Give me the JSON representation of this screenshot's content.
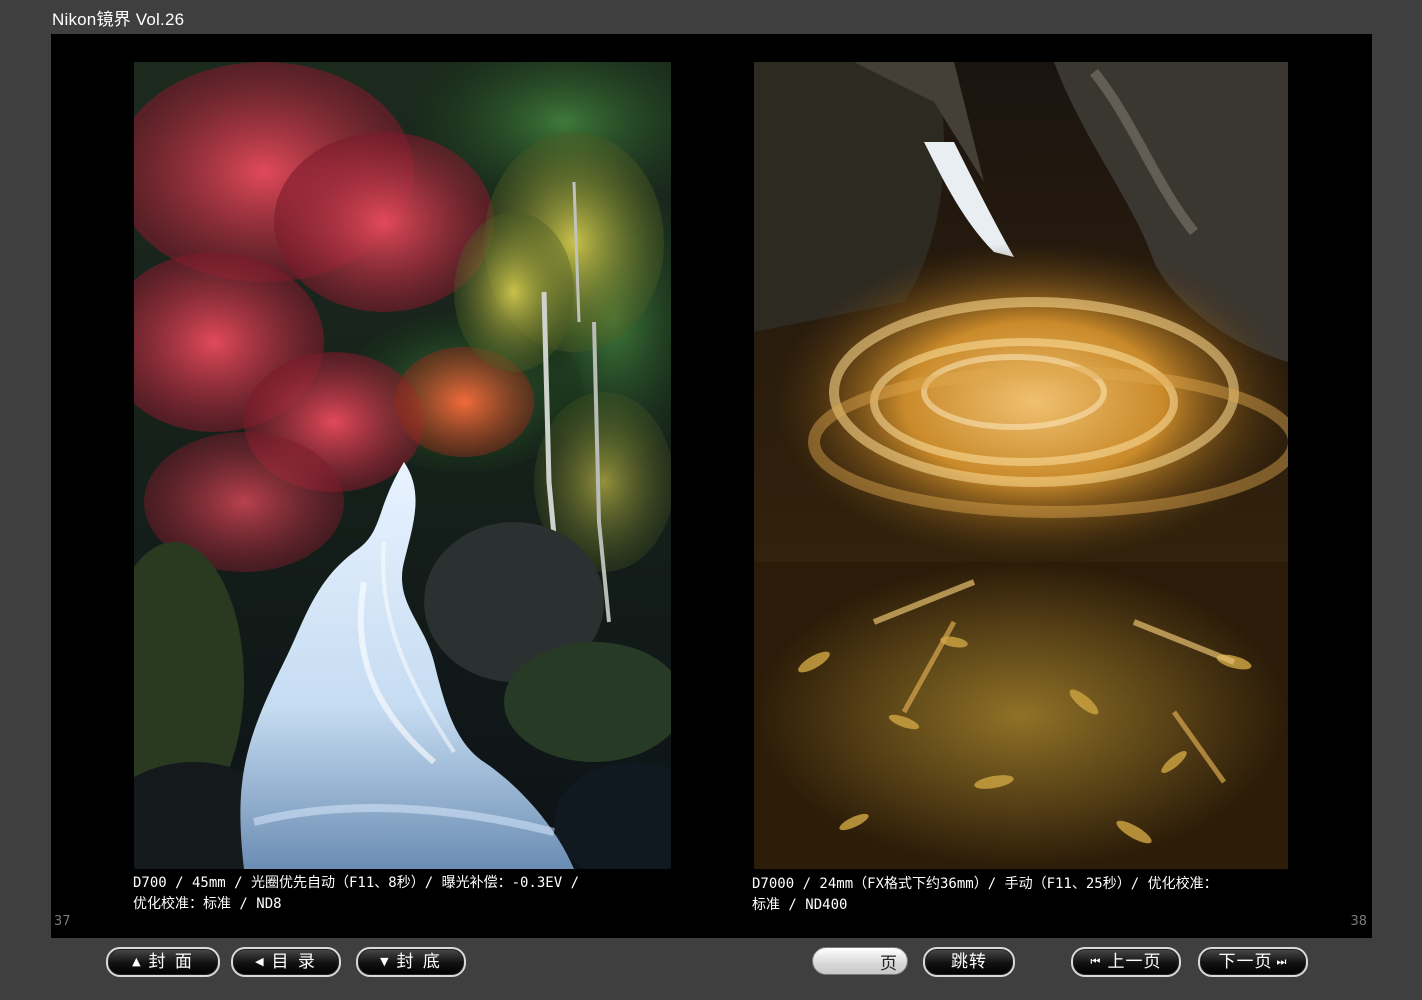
{
  "window": {
    "title": "Nikon镜界 Vol.26"
  },
  "spread": {
    "left_page": {
      "number": "37",
      "photo_subject": "autumn-waterfall-photo",
      "caption": "D700 / 45mm / 光圈优先自动（F11、8秒）/ 曝光补偿：-0.3EV /\n优化校准：标准 / ND8"
    },
    "right_page": {
      "number": "38",
      "photo_subject": "swirling-leaves-pool-photo",
      "caption": "D7000 / 24mm（FX格式下约36mm）/ 手动（F11、25秒）/ 优化校准：\n标准 / ND400"
    }
  },
  "toolbar": {
    "cover_label": "封 面",
    "toc_label": "目 录",
    "back_cover_label": "封 底",
    "page_input_value": "",
    "page_unit": "页",
    "jump_label": "跳转",
    "prev_label": "上一页",
    "next_label": "下一页",
    "icons": {
      "cover": "triangle-up-icon",
      "toc": "triangle-left-icon",
      "back_cover": "triangle-down-icon",
      "prev": "skip-back-icon",
      "next": "skip-forward-icon"
    }
  },
  "colors": {
    "background": "#3f3f3f",
    "spread_background": "#000000",
    "button_border": "#d9d9d9",
    "caption_text": "#ffffff"
  }
}
